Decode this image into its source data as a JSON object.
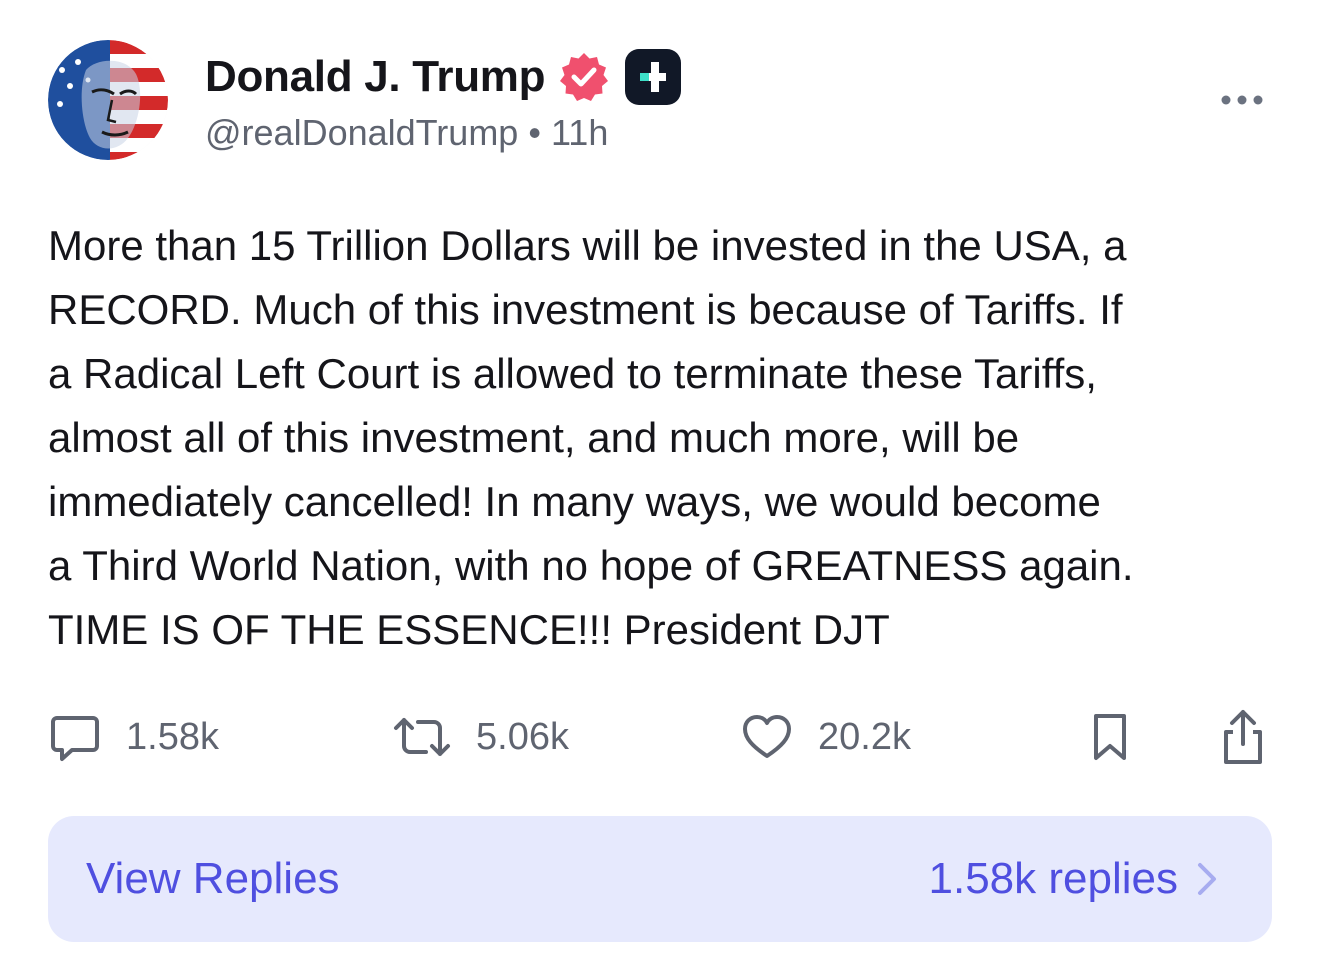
{
  "author": {
    "display_name": "Donald J. Trump",
    "handle": "@realDonaldTrump",
    "timestamp": "11h",
    "separator": "•",
    "badges": [
      "verified-badge-icon",
      "truth-plus-icon"
    ]
  },
  "post": {
    "lines": [
      "More than 15 Trillion Dollars will be invested in the USA, a",
      "RECORD. Much of this investment is because of Tariffs. If",
      "a Radical Left Court is allowed to terminate these Tariffs,",
      "almost all of this investment, and much more, will be",
      "immediately cancelled! In many ways, we would become",
      "a Third World Nation, with no hope of GREATNESS again.",
      "TIME IS OF THE ESSENCE!!! President DJT"
    ]
  },
  "actions": {
    "replies": "1.58k",
    "retruths": "5.06k",
    "likes": "20.2k"
  },
  "replies_bar": {
    "label": "View Replies",
    "count_label": "1.58k replies"
  },
  "colors": {
    "accent": "#4f4fe0",
    "replies_bg": "#e6e9fd",
    "verified": "#f0506e",
    "muted_text": "#5f6470"
  }
}
